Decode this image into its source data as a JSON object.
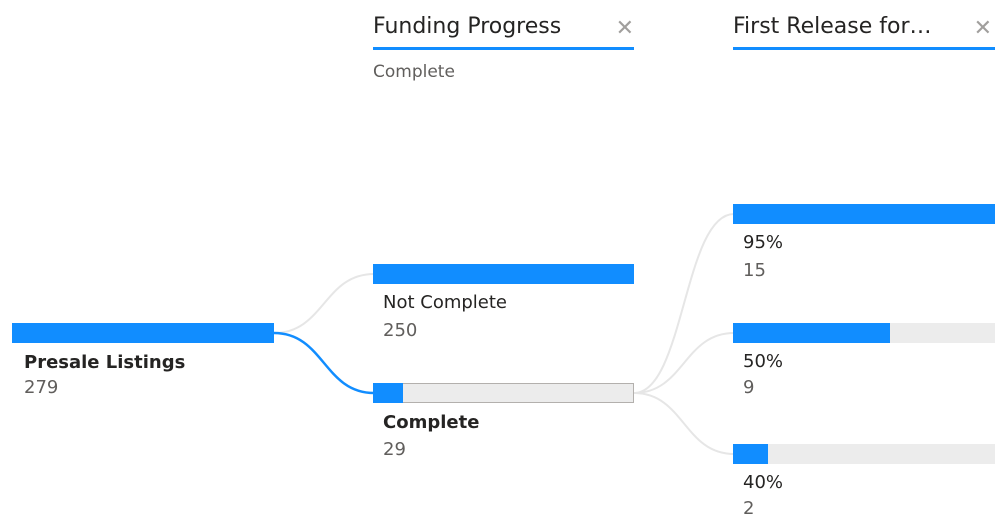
{
  "accent_color": "#118dff",
  "columns": [
    {
      "title": "Funding Progress",
      "close_icon": "close-icon",
      "subtitle": "Complete"
    },
    {
      "title": "First Release for…",
      "close_icon": "close-icon",
      "subtitle": ""
    }
  ],
  "root": {
    "label": "Presale Listings",
    "value": "279",
    "fill": 1.0
  },
  "funding_nodes": [
    {
      "label": "Not Complete",
      "value": "250",
      "fill": 1.0,
      "selected": false
    },
    {
      "label": "Complete",
      "value": "29",
      "fill": 0.116,
      "selected": true
    }
  ],
  "release_nodes": [
    {
      "label": "95%",
      "value": "15",
      "fill": 1.0
    },
    {
      "label": "50%",
      "value": "9",
      "fill": 0.6
    },
    {
      "label": "40%",
      "value": "2",
      "fill": 0.133
    }
  ]
}
